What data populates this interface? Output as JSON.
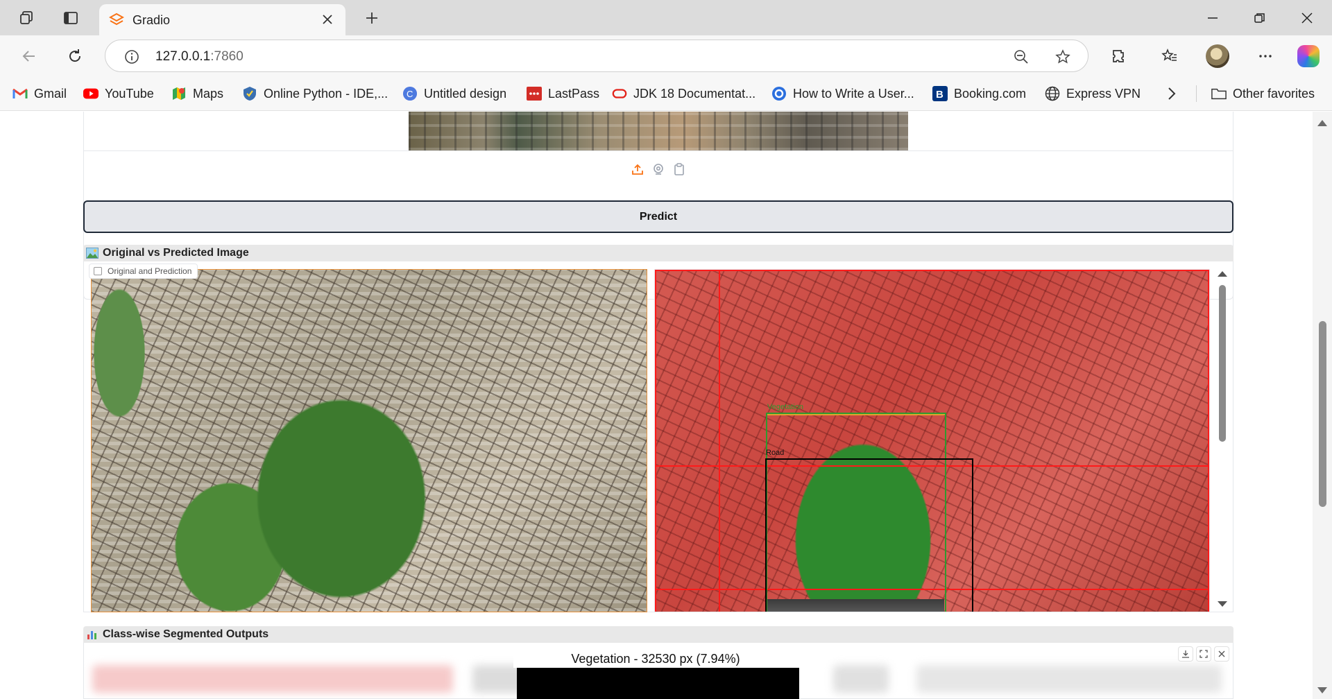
{
  "browser": {
    "tab_title": "Gradio",
    "url_host": "127.0.0.1",
    "url_port": ":7860"
  },
  "bookmarks": [
    {
      "label": "Gmail",
      "icon": "gmail-icon"
    },
    {
      "label": "YouTube",
      "icon": "youtube-icon"
    },
    {
      "label": "Maps",
      "icon": "maps-icon"
    },
    {
      "label": "Online Python - IDE,...",
      "icon": "python-icon"
    },
    {
      "label": "Untitled design",
      "icon": "canva-icon"
    },
    {
      "label": "LastPass",
      "icon": "lastpass-icon"
    },
    {
      "label": "JDK 18 Documentat...",
      "icon": "oracle-icon"
    },
    {
      "label": "How to Write a User...",
      "icon": "q-icon"
    },
    {
      "label": "Booking.com",
      "icon": "booking-icon"
    },
    {
      "label": "Express VPN",
      "icon": "globe-icon"
    }
  ],
  "other_favorites": "Other favorites",
  "app": {
    "predict_label": "Predict",
    "section1_title": "Original vs Predicted Image",
    "gallery_label": "Original and Prediction",
    "box_labels": [
      "Vegetation",
      "Road"
    ],
    "section2_title": "Class-wise Segmented Outputs",
    "segment_caption": "Vegetation - 32530 px (7.94%)"
  },
  "colors": {
    "accent": "#e8913a",
    "prediction_overlay": "#d04a44",
    "vegetation": "#2e8a2e",
    "box_red": "#ff1a1a",
    "box_green": "#2f9a2f",
    "box_black": "#000000"
  }
}
